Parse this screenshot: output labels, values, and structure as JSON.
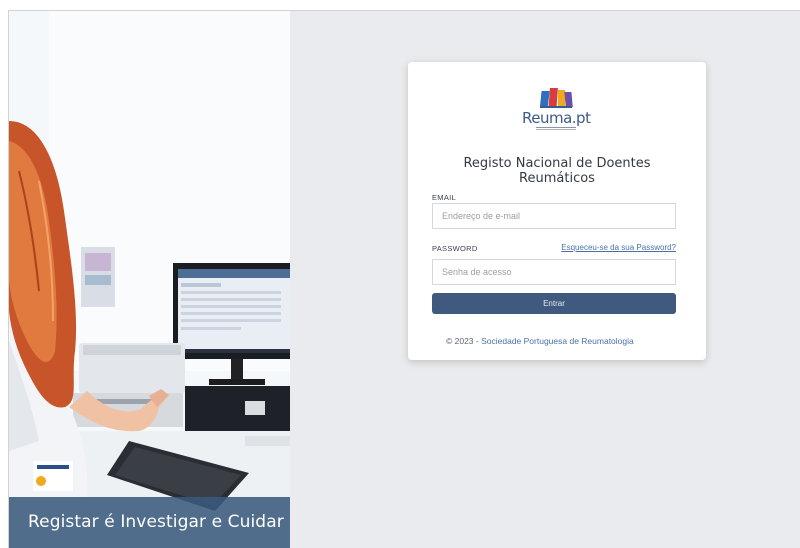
{
  "banner": {
    "caption": "Registar é Investigar e Cuidar"
  },
  "logo": {
    "wordmark": "Reuma.pt",
    "icon": "reuma-books-logo-icon"
  },
  "form": {
    "title": "Registo Nacional de Doentes Reumáticos",
    "email_label": "EMAIL",
    "email_placeholder": "Endereço de e-mail",
    "email_value": "",
    "password_label": "PASSWORD",
    "forgot_link": "Esqueceu-se da sua Password?",
    "password_placeholder": "Senha de acesso",
    "password_value": "",
    "submit_label": "Entrar"
  },
  "footer": {
    "copyright": "© 2023 -",
    "organization": "Sociedade Portuguesa de Reumatologia"
  },
  "colors": {
    "button": "#3f5a7e",
    "link": "#4a72a8",
    "caption_bg": "#3a5a7d",
    "page_bg": "#e9ebee"
  }
}
